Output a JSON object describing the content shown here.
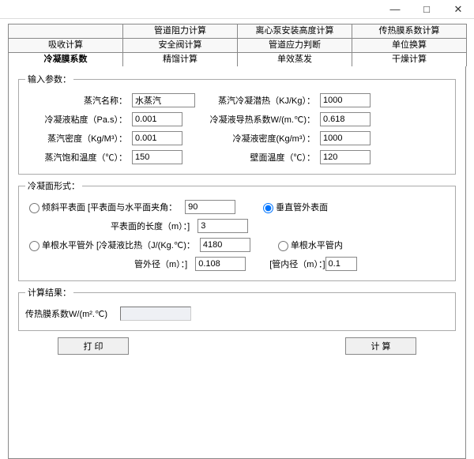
{
  "window": {
    "min": "—",
    "max": "□",
    "close": "✕"
  },
  "tabs": {
    "row1": [
      "",
      "管道阻力计算",
      "离心泵安装高度计算",
      "传热膜系数计算"
    ],
    "row2": [
      "吸收计算",
      "安全阀计算",
      "管道应力判断",
      "单位换算"
    ],
    "row3": [
      "冷凝膜系数",
      "精馏计算",
      "单效蒸发",
      "干燥计算"
    ]
  },
  "legend": {
    "inputs": "输入参数：",
    "form": "冷凝面形式：",
    "result": "计算结果："
  },
  "labels": {
    "name": "蒸汽名称：",
    "latent": "蒸汽冷凝潜热（KJ/Kg）：",
    "visc": "冷凝液粘度（Pa.s）：",
    "cond": "冷凝液导热系数W/(m.℃)：",
    "vden": "蒸汽密度（Kg/M³）：",
    "lden": "冷凝液密度(Kg/m³）：",
    "sat": "蒸汽饱和温度（℃）：",
    "wall": "壁面温度（℃）：",
    "r1": "倾斜平表面 [平表面与水平面夹角：",
    "r1b": "平表面的长度（m）：]",
    "r2": "垂直管外表面",
    "r3": "单根水平管外 [冷凝液比热（J/(Kg.℃)：",
    "r3b": "管外径（m）：]",
    "r4": "单根水平管内",
    "r4b": "[管内径（m）：]",
    "result": "传热膜系数W/(m².℃)"
  },
  "values": {
    "name": "水蒸汽",
    "latent": "1000",
    "visc": "0.001",
    "cond": "0.618",
    "vden": "0.001",
    "lden": "1000",
    "sat": "150",
    "wall": "120",
    "angle": "90",
    "length": "3",
    "cp": "4180",
    "od": "0.108",
    "id": "0.1",
    "result": ""
  },
  "buttons": {
    "print": "打 印",
    "calc": "计 算"
  }
}
